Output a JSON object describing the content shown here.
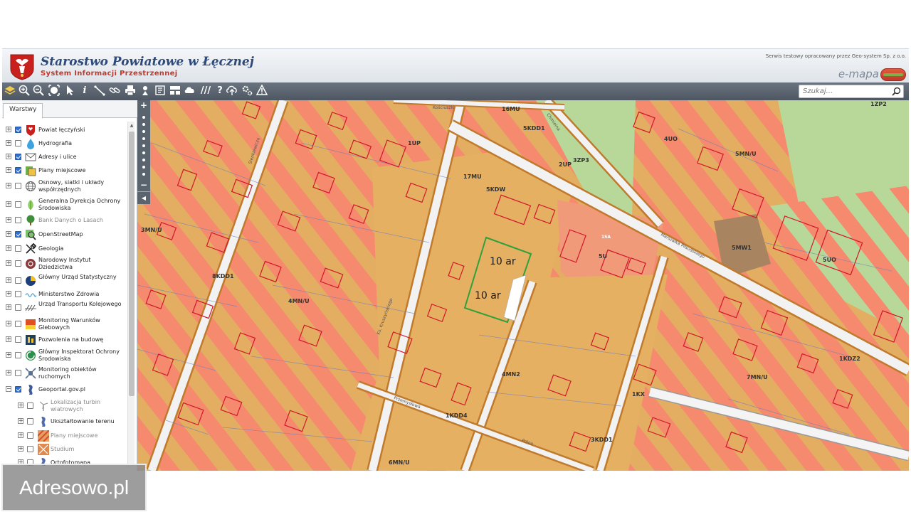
{
  "header": {
    "title": "Starostwo Powiatowe w Łęcznej",
    "subtitle": "System Informacji Przestrzennej",
    "service_note": "Serwis testowy opracowany przez Geo-system Sp. z o.o.",
    "brand": "e-mapa"
  },
  "toolbar": {
    "tools": [
      "layers-icon",
      "zoom-in-icon",
      "zoom-out-icon",
      "zoom-extent-icon",
      "select-arrow-icon",
      "info-icon",
      "measure-line-icon",
      "link-icon",
      "print-icon",
      "locate-icon",
      "export-icon",
      "layout-icon",
      "cloud-icon",
      "hatch-icon",
      "help-icon",
      "upload-icon",
      "settings-icon",
      "warning-icon"
    ],
    "search_placeholder": "Szukaj..."
  },
  "sidebar": {
    "tab": "Warstwy",
    "layers": [
      {
        "label": "Powiat łęczyński",
        "checked": true,
        "icon": "coat-of-arms-icon",
        "gray": false
      },
      {
        "label": "Hydrografia",
        "checked": false,
        "icon": "water-drop-icon",
        "gray": false
      },
      {
        "label": "Adresy i ulice",
        "checked": true,
        "icon": "envelope-icon",
        "gray": false
      },
      {
        "label": "Plany miejscowe",
        "checked": true,
        "icon": "plan-icon",
        "gray": false
      },
      {
        "label": "Osnowy, siatki i układy współrzędnych",
        "checked": false,
        "icon": "globe-icon",
        "gray": false
      },
      {
        "label": "Generalna Dyrekcja Ochrony Środowiska",
        "checked": false,
        "icon": "leaf-icon",
        "gray": false
      },
      {
        "label": "Bank Danych o Lasach",
        "checked": false,
        "icon": "tree-icon",
        "gray": true
      },
      {
        "label": "OpenStreetMap",
        "checked": true,
        "icon": "map-magnifier-icon",
        "gray": false
      },
      {
        "label": "Geologia",
        "checked": false,
        "icon": "hammer-icon",
        "gray": false
      },
      {
        "label": "Narodowy Instytut Dziedzictwa",
        "checked": false,
        "icon": "heritage-icon",
        "gray": false
      },
      {
        "label": "Główny Urząd Statystyczny",
        "checked": false,
        "icon": "statistics-icon",
        "gray": false
      },
      {
        "label": "Ministerstwo Zdrowia",
        "checked": false,
        "icon": "health-wave-icon",
        "gray": false
      },
      {
        "label": "Urząd Transportu Kolejowego",
        "checked": false,
        "icon": "rail-icon",
        "gray": false
      },
      {
        "label": "Monitoring Warunków Glebowych",
        "checked": false,
        "icon": "soil-icon",
        "gray": false
      },
      {
        "label": "Pozwolenia na budowę",
        "checked": false,
        "icon": "building-permit-icon",
        "gray": false
      },
      {
        "label": "Główny Inspektorat Ochrony Środowiska",
        "checked": false,
        "icon": "environment-icon",
        "gray": false
      },
      {
        "label": "Monitoring obiektów ruchomych",
        "checked": false,
        "icon": "satellite-icon",
        "gray": false
      },
      {
        "label": "Geoportal.gov.pl",
        "checked": true,
        "icon": "geoportal-icon",
        "gray": false
      },
      {
        "label": "Lokalizacja turbin wiatrowych",
        "checked": false,
        "icon": "wind-turbine-icon",
        "gray": true
      },
      {
        "label": "Ukształtowanie terenu",
        "checked": false,
        "icon": "terrain-icon",
        "gray": false
      },
      {
        "label": "Plany miejscowe",
        "checked": false,
        "icon": "plan-thumb-icon",
        "gray": true
      },
      {
        "label": "Studium",
        "checked": false,
        "icon": "study-thumb-icon",
        "gray": true
      },
      {
        "label": "Ortofotomapa",
        "checked": false,
        "icon": "ortho-icon",
        "gray": false
      }
    ]
  },
  "map": {
    "zones": [
      "1ZP2",
      "16MU",
      "5KDD1",
      "1UP",
      "4UO",
      "5MN/U",
      "3ZP3",
      "2UP",
      "17MU",
      "5KDW",
      "3MN/U",
      "8KDD1",
      "4MN/U",
      "5U",
      "5MW1",
      "5UO",
      "4MN2",
      "1KX",
      "7MN/U",
      "1KDD4",
      "3KDD1",
      "6MN/U",
      "1KDZ2",
      "15A"
    ],
    "area_labels": [
      "10 ar",
      "10 ar"
    ],
    "streets": [
      "Kościuszki",
      "Chmielna",
      "Marszałka Piłsudskiego",
      "Sienkiewicza",
      "Ks. Kruszyńskiego",
      "Przemysłowa",
      "Polna"
    ]
  },
  "watermark": "Adresowo.pl"
}
